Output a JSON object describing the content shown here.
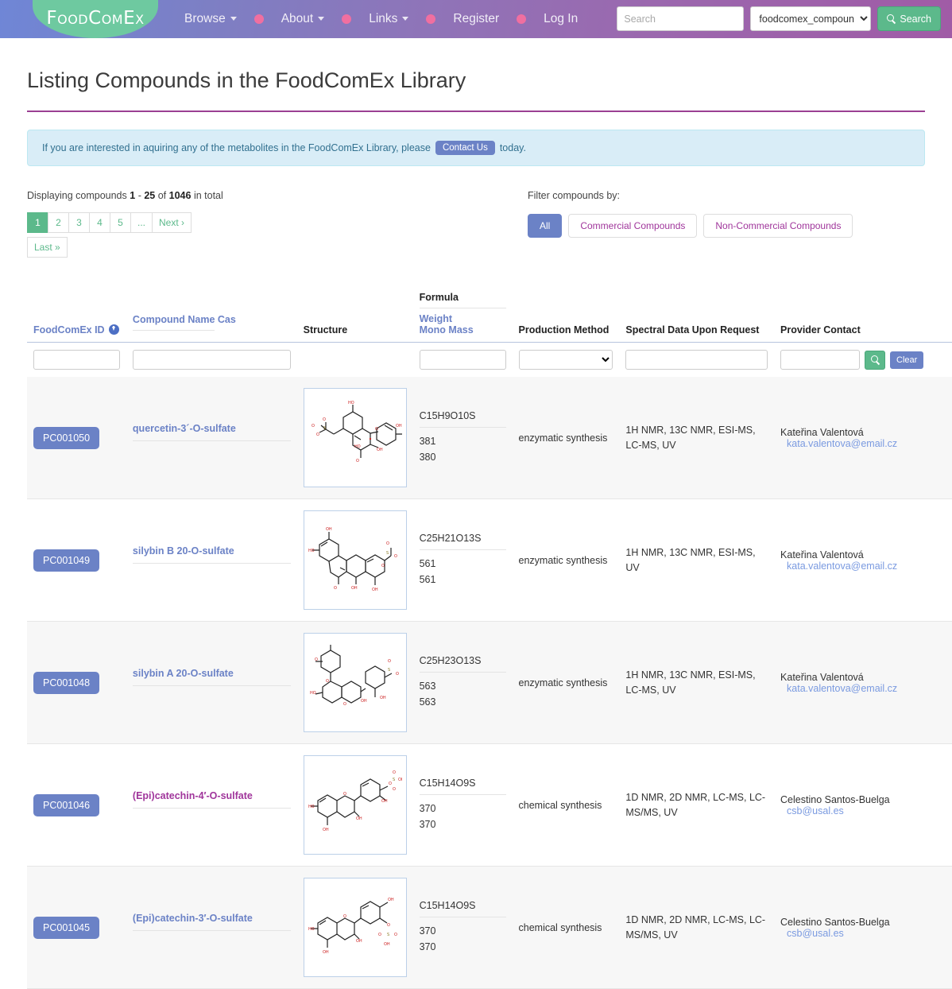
{
  "navbar": {
    "logo": "FoodComEx",
    "items": [
      {
        "label": "Browse",
        "caret": true
      },
      {
        "label": "About",
        "caret": true
      },
      {
        "label": "Links",
        "caret": true
      },
      {
        "label": "Register",
        "caret": false
      },
      {
        "label": "Log In",
        "caret": false
      }
    ],
    "search": {
      "placeholder": "Search",
      "value": "",
      "selected_db": "foodcomex_compounds",
      "button_label": "Search",
      "button_icon": "search-icon"
    }
  },
  "page": {
    "title": "Listing Compounds in the FoodComEx Library",
    "notice_before": "If you are interested in aquiring any of the metabolites in the FoodComEx Library, please",
    "notice_badge": "Contact Us",
    "notice_after": "today."
  },
  "summary": {
    "prefix": "Displaying compounds",
    "range_start": "1",
    "dash": "-",
    "range_end": "25",
    "of": "of",
    "total": "1046",
    "suffix": "in total"
  },
  "pagination": {
    "pages": [
      "1",
      "2",
      "3",
      "4",
      "5",
      "...",
      "Next ›"
    ],
    "active_index": 0,
    "last_label": "Last »"
  },
  "filters": {
    "label": "Filter compounds by:",
    "buttons": [
      {
        "label": "All",
        "active": true
      },
      {
        "label": "Commercial Compounds",
        "active": false
      },
      {
        "label": "Non-Commercial Compounds",
        "active": false
      }
    ]
  },
  "table": {
    "headers": {
      "id": "FoodComEx ID",
      "id_sort_icon": "sort-descending-icon",
      "compound_name": "Compound Name",
      "cas": "Cas",
      "structure": "Structure",
      "formula": "Formula",
      "weight": "Weight",
      "mono_mass": "Mono Mass",
      "production_method": "Production Method",
      "spectral": "Spectral Data Upon Request",
      "provider": "Provider Contact"
    },
    "filter_row": {
      "id_value": "",
      "name_value": "",
      "formula_value": "",
      "production_value": "",
      "spectral_value": "",
      "provider_value": "",
      "search_icon": "search-icon",
      "clear_label": "Clear"
    },
    "rows": [
      {
        "id": "PC001050",
        "name": "quercetin-3´-O-sulfate",
        "name_color": "blue",
        "cas": "",
        "structure_icon": "molecule-structure-quercetin-3-o-sulfate",
        "formula": "C15H9O10S",
        "weight": "381",
        "mono_mass": "380",
        "production_method": "enzymatic synthesis",
        "spectral_data": "1H NMR, 13C NMR, ESI-MS, LC-MS, UV",
        "provider_name": "Kateřina Valentová",
        "provider_email": "kata.valentova@email.cz"
      },
      {
        "id": "PC001049",
        "name": "silybin B 20-O-sulfate",
        "name_color": "blue",
        "cas": "",
        "structure_icon": "molecule-structure-silybin-b-20-o-sulfate",
        "formula": "C25H21O13S",
        "weight": "561",
        "mono_mass": "561",
        "production_method": "enzymatic synthesis",
        "spectral_data": "1H NMR, 13C NMR, ESI-MS, UV",
        "provider_name": "Kateřina Valentová",
        "provider_email": "kata.valentova@email.cz"
      },
      {
        "id": "PC001048",
        "name": "silybin A 20-O-sulfate",
        "name_color": "blue",
        "cas": "",
        "structure_icon": "molecule-structure-silybin-a-20-o-sulfate",
        "formula": "C25H23O13S",
        "weight": "563",
        "mono_mass": "563",
        "production_method": "enzymatic synthesis",
        "spectral_data": "1H NMR, 13C NMR, ESI-MS, LC-MS, UV",
        "provider_name": "Kateřina Valentová",
        "provider_email": "kata.valentova@email.cz"
      },
      {
        "id": "PC001046",
        "name": "(Epi)catechin-4′-O-sulfate",
        "name_color": "magenta",
        "cas": "",
        "structure_icon": "molecule-structure-epicatechin-4-o-sulfate",
        "formula": "C15H14O9S",
        "weight": "370",
        "mono_mass": "370",
        "production_method": "chemical synthesis",
        "spectral_data": "1D NMR, 2D NMR, LC-MS, LC-MS/MS, UV",
        "provider_name": "Celestino Santos-Buelga",
        "provider_email": "csb@usal.es"
      },
      {
        "id": "PC001045",
        "name": "(Epi)catechin-3′-O-sulfate",
        "name_color": "blue",
        "cas": "",
        "structure_icon": "molecule-structure-epicatechin-3-o-sulfate",
        "formula": "C15H14O9S",
        "weight": "370",
        "mono_mass": "370",
        "production_method": "chemical synthesis",
        "spectral_data": "1D NMR, 2D NMR, LC-MS, LC-MS/MS, UV",
        "provider_name": "Celestino Santos-Buelga",
        "provider_email": "csb@usal.es"
      }
    ]
  },
  "colors": {
    "brand_green": "#6ec9a0",
    "accent_blue": "#6b82c6",
    "accent_magenta": "#a0359b",
    "nav_dot_pink": "#f06fa0",
    "title_rule": "#9b3f93",
    "alert_bg": "#d9edf7"
  }
}
